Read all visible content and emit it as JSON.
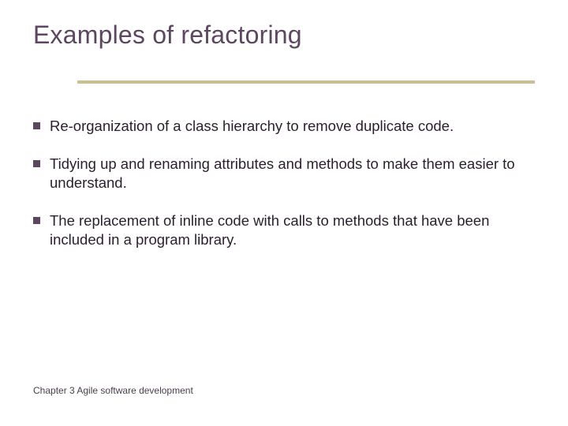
{
  "title": "Examples of refactoring",
  "bullets": [
    "Re-organization of a class hierarchy to remove duplicate code.",
    "Tidying up and renaming attributes and methods to make them easier to understand.",
    "The replacement of inline code with calls to methods that have been included in a program library."
  ],
  "footer": "Chapter 3 Agile software development"
}
